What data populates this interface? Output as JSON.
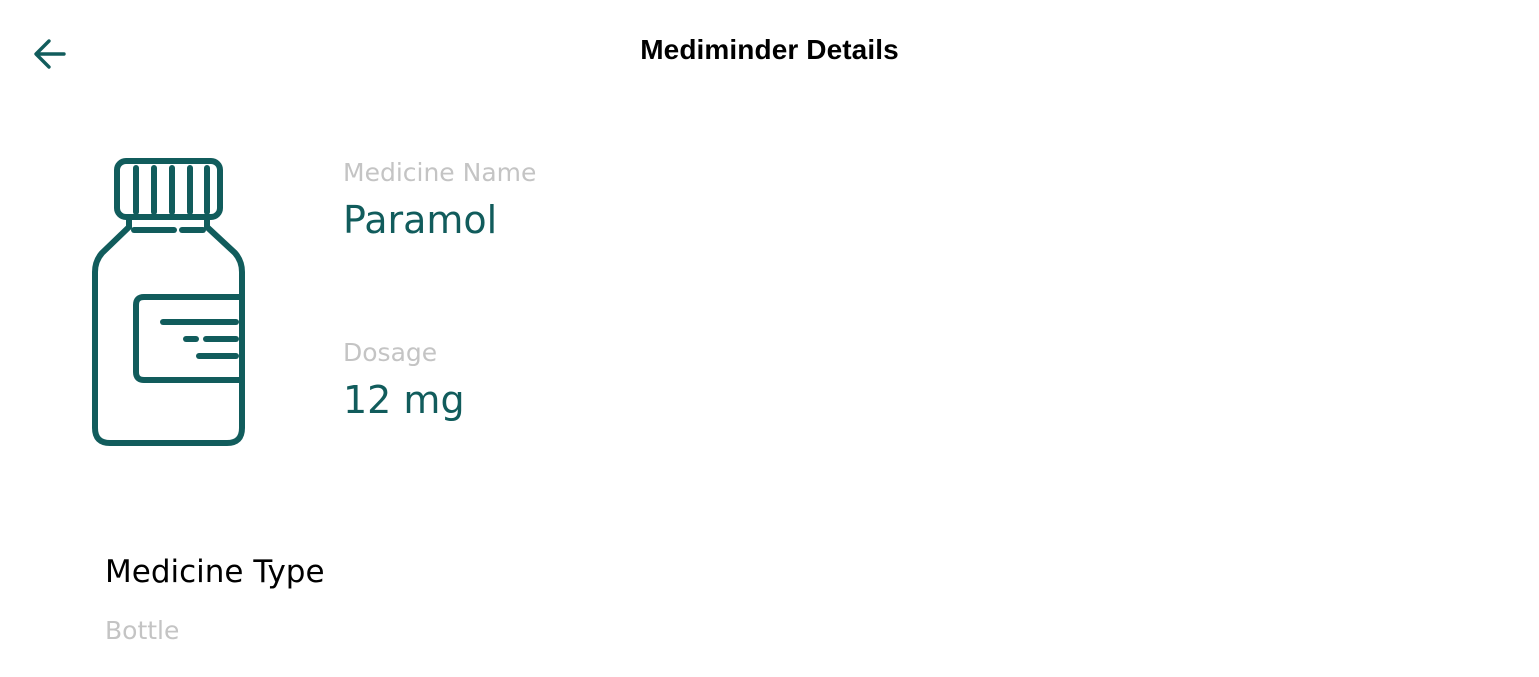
{
  "header": {
    "title": "Mediminder Details",
    "back_icon": "arrow-left-icon"
  },
  "medicine": {
    "image_icon": "medicine-bottle-icon",
    "name_label": "Medicine Name",
    "name_value": "Paramol",
    "dosage_label": "Dosage",
    "dosage_value": "12 mg",
    "type_heading": "Medicine Type",
    "type_value": "Bottle"
  },
  "colors": {
    "accent": "#115c5c",
    "muted_label": "#c4c4c4",
    "title_text": "#000000",
    "background": "#ffffff"
  }
}
